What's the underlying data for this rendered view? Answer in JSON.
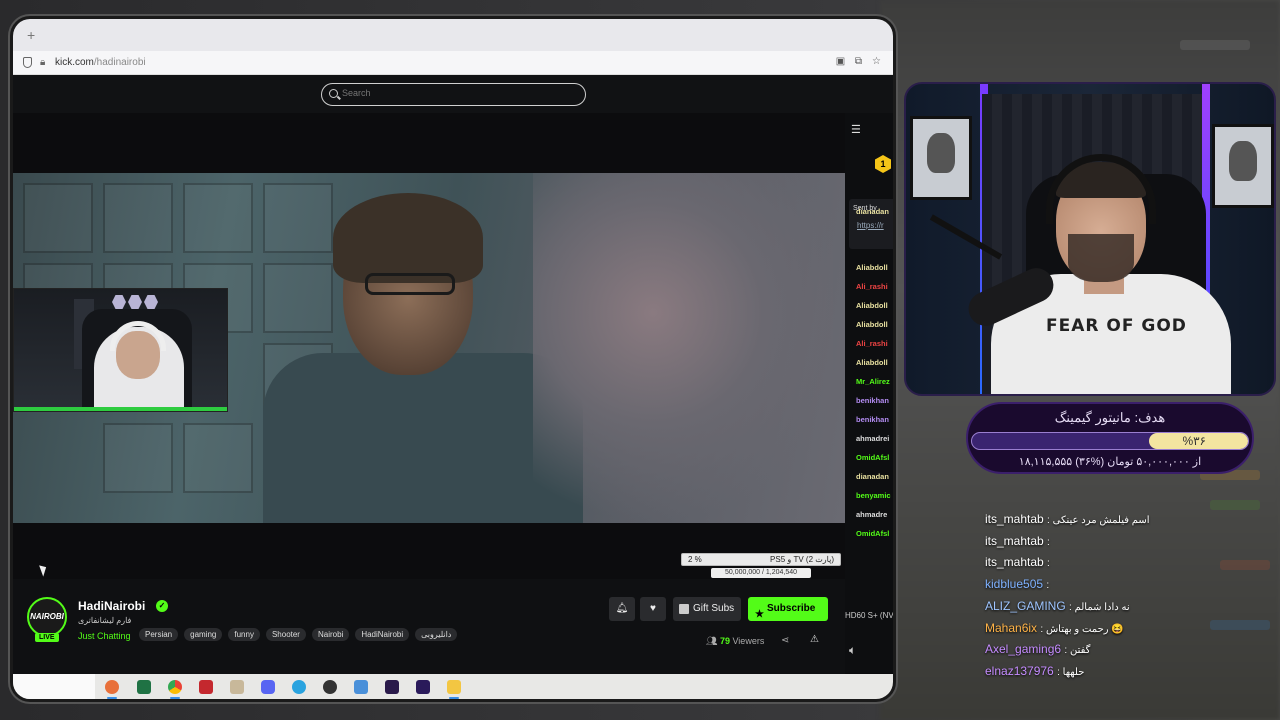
{
  "browser": {
    "url_domain": "kick.com",
    "url_path": "/hadinairobi",
    "tab_plus": "+",
    "search_placeholder": "Search"
  },
  "video_overlay": {
    "donation_goal_text": "PS5 و TV (پارت 2)",
    "donation_percent": "2 %",
    "donation_amounts": "50,000,000 / 1,204,540"
  },
  "channel": {
    "name": "HadiNairobi",
    "avatar_text": "NAIROBI",
    "live_label": "LIVE",
    "title": "فارم لیشانفاتری",
    "category": "Just Chatting",
    "tags": [
      "Persian",
      "gaming",
      "funny",
      "Shooter",
      "Nairobi",
      "HadiNairobi",
      "دانلیروبی"
    ],
    "gift_subs_label": "Gift Subs",
    "subscribe_label": "Subscribe",
    "viewers_count": "79",
    "viewers_label": "Viewers"
  },
  "kick_chat": {
    "coin_value": "1",
    "pinned_sent_by": "Sent by",
    "pinned_link": "https://r",
    "usernames": [
      {
        "name": "dianadan",
        "color": "#e8e0a0"
      },
      {
        "name": "Aliabdoll",
        "color": "#e8e0a0"
      },
      {
        "name": "Ali_rashi",
        "color": "#e44"
      },
      {
        "name": "Aliabdoll",
        "color": "#e8e0a0"
      },
      {
        "name": "Aliabdoll",
        "color": "#e8e0a0"
      },
      {
        "name": "Ali_rashi",
        "color": "#e44"
      },
      {
        "name": "Aliabdoll",
        "color": "#e8e0a0"
      },
      {
        "name": "Mr_Alirez",
        "color": "#53fc18"
      },
      {
        "name": "benikhan",
        "color": "#b38cf2"
      },
      {
        "name": "benikhan",
        "color": "#b38cf2"
      },
      {
        "name": "ahmadrei",
        "color": "#ddd"
      },
      {
        "name": "OmidAfsl",
        "color": "#53fc18"
      },
      {
        "name": "dianadan",
        "color": "#e8e0a0"
      },
      {
        "name": "benyamic",
        "color": "#53fc18"
      },
      {
        "name": "ahmadre",
        "color": "#ddd"
      },
      {
        "name": "OmidAfsl",
        "color": "#53fc18"
      }
    ],
    "quality_label": "HD60 S+ (NV"
  },
  "stream_goal": {
    "title": "هدف: مانیتور گیمینگ",
    "percent_label": "%۳۶",
    "percent": 36,
    "amount_text": "۱۸,۱۱۵,۵۵۵ از ۵۰,۰۰۰,۰۰۰ تومان (%۳۶)"
  },
  "overlay_chat": [
    {
      "user": "its_mahtab",
      "text": ": اسم فیلمش مرد عینکی",
      "color": "#ffffff"
    },
    {
      "user": "its_mahtab",
      "text": ":",
      "color": "#ffffff"
    },
    {
      "user": "its_mahtab",
      "text": ":",
      "color": "#ffffff"
    },
    {
      "user": "kidblue505",
      "text": ":",
      "color": "#7fb2ff"
    },
    {
      "user": "ALIZ_GAMING",
      "text": ": نه دادا شمالم",
      "color": "#9ec5ff"
    },
    {
      "user": "Mahan6ix",
      "text": ": رحمت و بهتاش 😆",
      "color": "#ffb347"
    },
    {
      "user": "Axel_gaming6",
      "text": ": گفتن",
      "color": "#c58cff"
    },
    {
      "user": "elnaz137976",
      "text": ": حلهها",
      "color": "#c58cff"
    }
  ],
  "colors": {
    "kick_green": "#53fc18",
    "goal_purple": "#1a0a2e",
    "goal_fill": "#f3e5a0"
  }
}
